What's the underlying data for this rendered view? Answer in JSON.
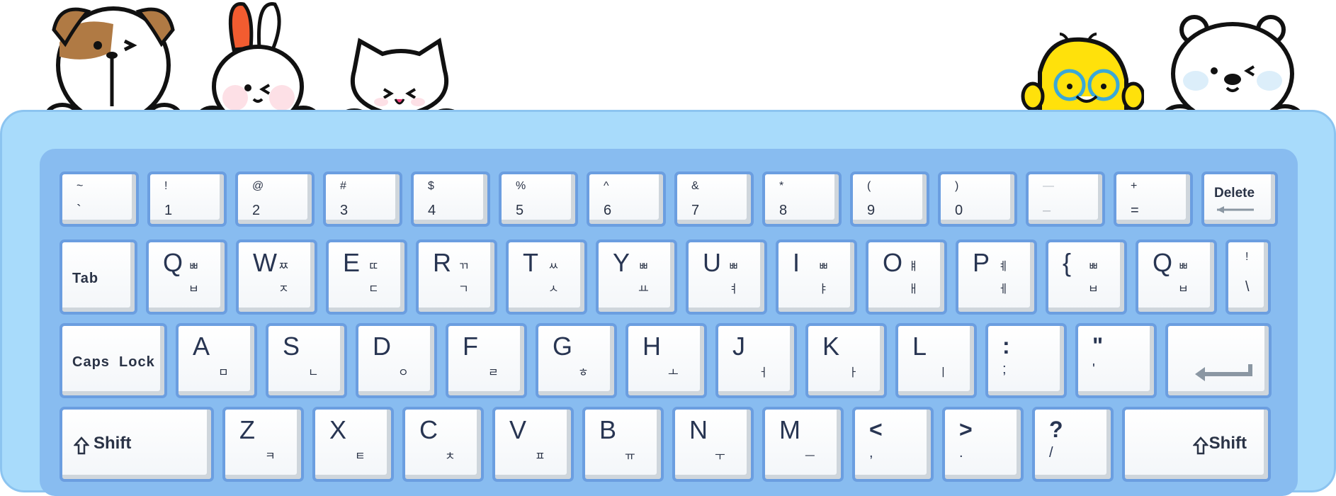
{
  "row1": [
    {
      "top": "~",
      "bottom": "`"
    },
    {
      "top": "!",
      "bottom": "1"
    },
    {
      "top": "@",
      "bottom": "2"
    },
    {
      "top": "#",
      "bottom": "3"
    },
    {
      "top": "$",
      "bottom": "4"
    },
    {
      "top": "%",
      "bottom": "5"
    },
    {
      "top": "^",
      "bottom": "6"
    },
    {
      "top": "&",
      "bottom": "7"
    },
    {
      "top": "*",
      "bottom": "8"
    },
    {
      "top": "(",
      "bottom": "9"
    },
    {
      "top": ")",
      "bottom": "0"
    },
    {
      "top": "—",
      "bottom": "–"
    },
    {
      "top": "+",
      "bottom": "="
    }
  ],
  "delete_label": "Delete",
  "tab_label": "Tab",
  "row2": [
    {
      "letter": "Q",
      "k_shift": "ㅃ",
      "k": "ㅂ"
    },
    {
      "letter": "W",
      "k_shift": "ㅉ",
      "k": "ㅈ"
    },
    {
      "letter": "E",
      "k_shift": "ㄸ",
      "k": "ㄷ"
    },
    {
      "letter": "R",
      "k_shift": "ㄲ",
      "k": "ㄱ"
    },
    {
      "letter": "T",
      "k_shift": "ㅆ",
      "k": "ㅅ"
    },
    {
      "letter": "Y",
      "k_shift": "ㅃ",
      "k": "ㅛ"
    },
    {
      "letter": "U",
      "k_shift": "ㅃ",
      "k": "ㅕ"
    },
    {
      "letter": "I",
      "k_shift": "ㅃ",
      "k": "ㅑ"
    },
    {
      "letter": "O",
      "k_shift": "ㅒ",
      "k": "ㅐ"
    },
    {
      "letter": "P",
      "k_shift": "ㅖ",
      "k": "ㅔ"
    },
    {
      "letter": "{",
      "k_shift": "ㅃ",
      "k": "ㅂ"
    },
    {
      "letter": "Q",
      "k_shift": "ㅃ",
      "k": "ㅂ"
    }
  ],
  "backslash": {
    "top": "!",
    "bottom": "\\"
  },
  "caps_label": "Caps  Lock",
  "row3": [
    {
      "letter": "A",
      "k": "ㅁ"
    },
    {
      "letter": "S",
      "k": "ㄴ"
    },
    {
      "letter": "D",
      "k": "ㅇ"
    },
    {
      "letter": "F",
      "k": "ㄹ"
    },
    {
      "letter": "G",
      "k": "ㅎ"
    },
    {
      "letter": "H",
      "k": "ㅗ"
    },
    {
      "letter": "J",
      "k": "ㅓ"
    },
    {
      "letter": "K",
      "k": "ㅏ"
    },
    {
      "letter": "L",
      "k": "ㅣ"
    }
  ],
  "semicolon": {
    "top": ":",
    "bottom": ";"
  },
  "quote": {
    "top": "\"",
    "bottom": "'"
  },
  "shift_label": "Shift",
  "row4": [
    {
      "letter": "Z",
      "k": "ㅋ"
    },
    {
      "letter": "X",
      "k": "ㅌ"
    },
    {
      "letter": "C",
      "k": "ㅊ"
    },
    {
      "letter": "V",
      "k": "ㅍ"
    },
    {
      "letter": "B",
      "k": "ㅠ"
    },
    {
      "letter": "N",
      "k": "ㅜ"
    },
    {
      "letter": "M",
      "k": "ㅡ"
    }
  ],
  "row4sym": [
    {
      "top": "<",
      "bottom": ","
    },
    {
      "top": ">",
      "bottom": "."
    },
    {
      "top": "?",
      "bottom": "/"
    }
  ],
  "icons": {
    "delete": "left-arrow-icon",
    "enter": "return-arrow-icon",
    "shift": "shift-arrow-icon"
  },
  "colors": {
    "frame": "#a8dbfb",
    "board": "#88bcf0",
    "key": "#ffffff",
    "key_border": "#6b9ee0",
    "text": "#2a3346"
  }
}
